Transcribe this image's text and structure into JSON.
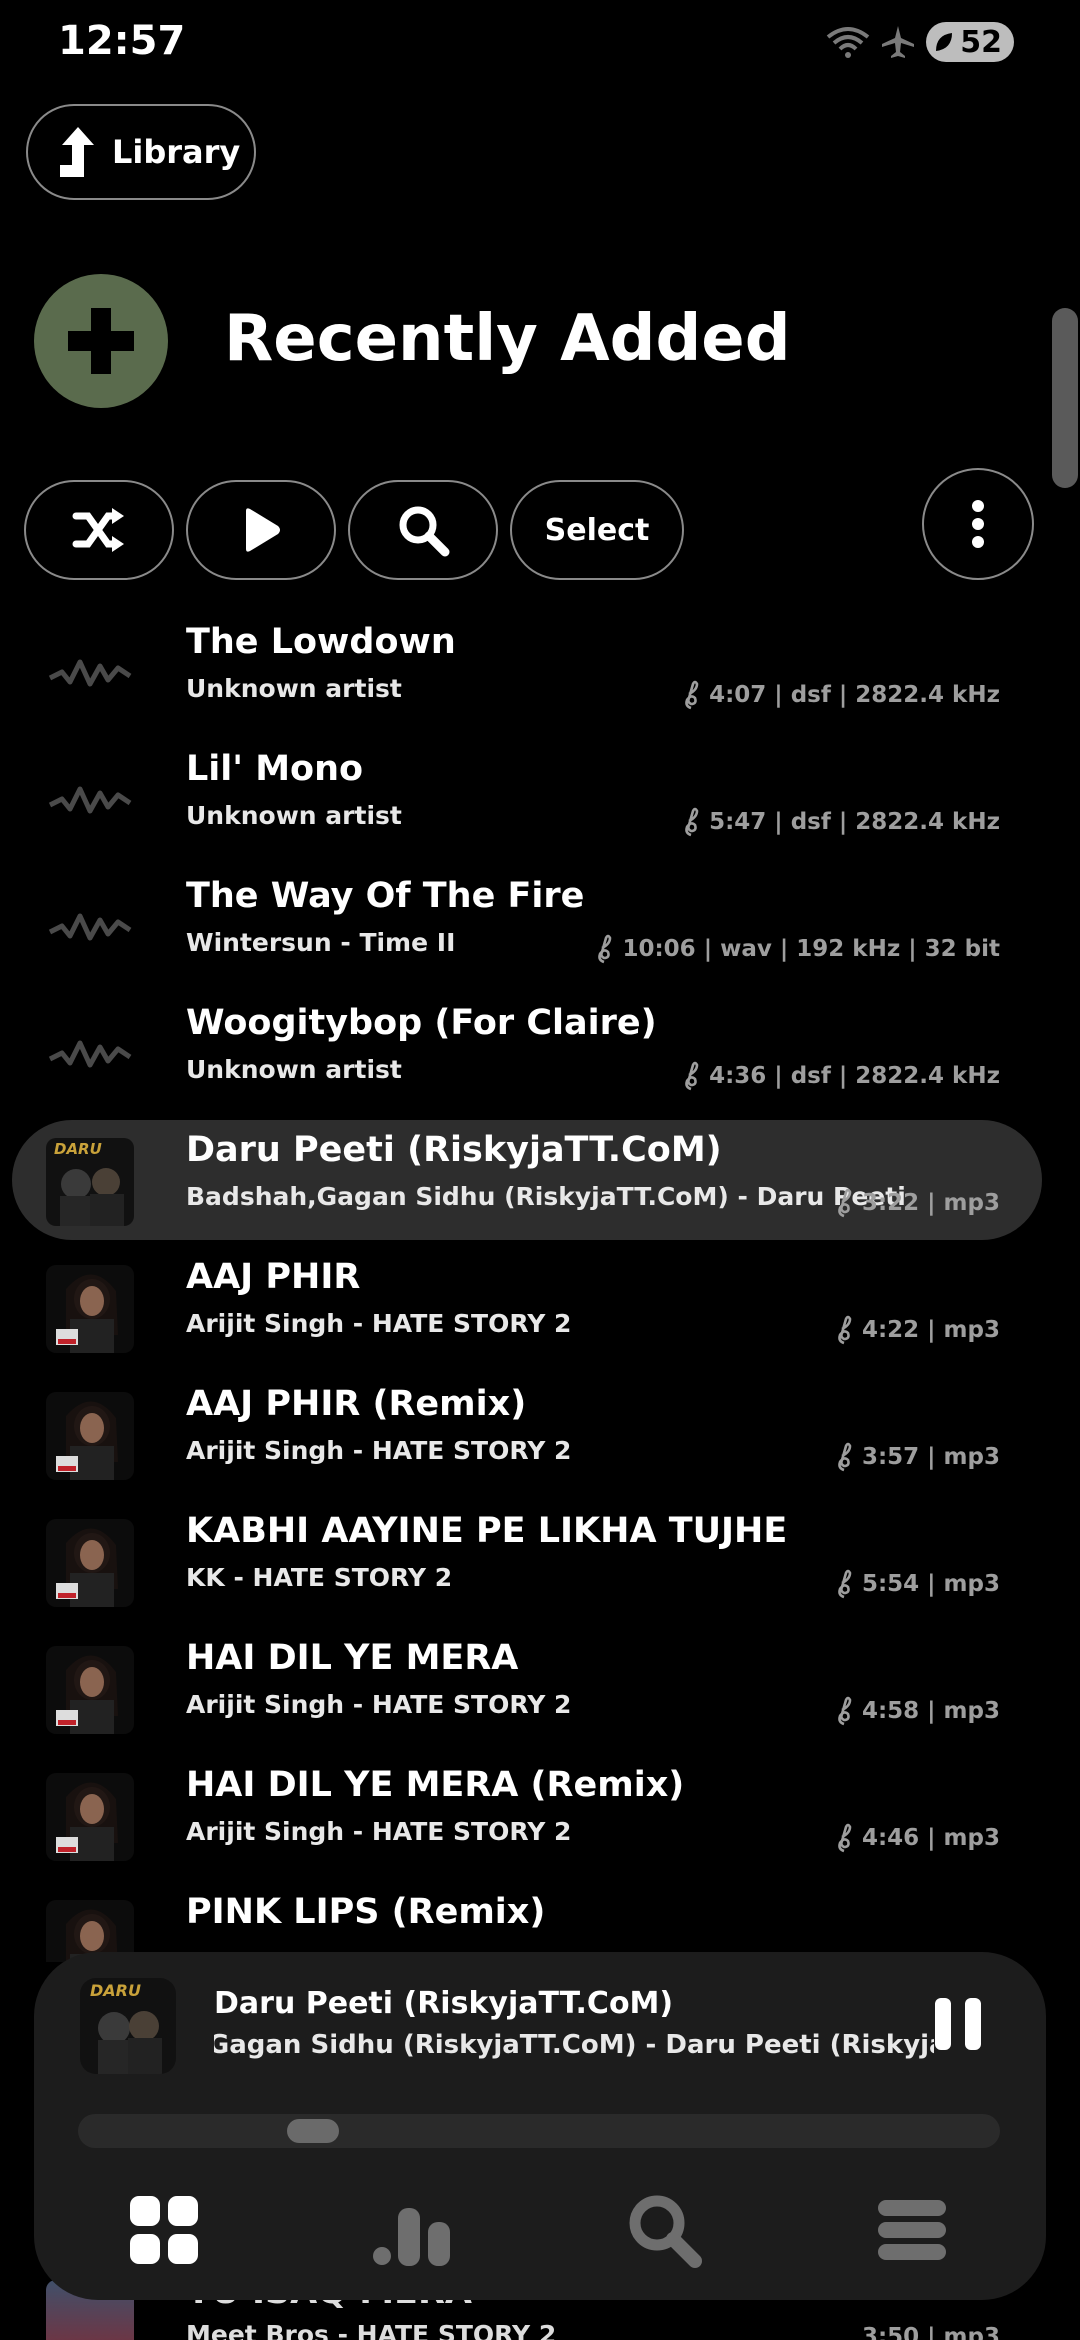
{
  "status_bar": {
    "time": "12:57",
    "battery": "52"
  },
  "library_button": {
    "label": "Library"
  },
  "page_title": "Recently Added",
  "toolbar": {
    "select_label": "Select"
  },
  "tracks": [
    {
      "title": "The Lowdown",
      "subtitle": "Unknown artist",
      "meta": "4:07 | dsf | 2822.4 kHz",
      "art": "waveform"
    },
    {
      "title": "Lil' Mono",
      "subtitle": "Unknown artist",
      "meta": "5:47 | dsf | 2822.4 kHz",
      "art": "waveform"
    },
    {
      "title": "The Way Of The Fire",
      "subtitle": "Wintersun - Time II",
      "meta": "10:06 | wav | 192 kHz | 32 bit",
      "art": "waveform"
    },
    {
      "title": "Woogitybop (For Claire)",
      "subtitle": "Unknown artist",
      "meta": "4:36 | dsf | 2822.4 kHz",
      "art": "waveform"
    },
    {
      "title": "Daru Peeti (RiskyjaTT.CoM)",
      "subtitle": "Badshah,Gagan Sidhu (RiskyjaTT.CoM) - Daru Peeti",
      "meta": "3:22 | mp3",
      "art": "album-daru",
      "active": true
    },
    {
      "title": "AAJ PHIR",
      "subtitle": "Arijit Singh - HATE STORY 2",
      "meta": "4:22 | mp3",
      "art": "album-hate-story"
    },
    {
      "title": "AAJ PHIR (Remix)",
      "subtitle": "Arijit Singh - HATE STORY 2",
      "meta": "3:57 | mp3",
      "art": "album-hate-story"
    },
    {
      "title": "KABHI AAYINE PE LIKHA TUJHE",
      "subtitle": "KK - HATE STORY 2",
      "meta": "5:54 | mp3",
      "art": "album-hate-story"
    },
    {
      "title": "HAI DIL YE MERA",
      "subtitle": "Arijit Singh - HATE STORY 2",
      "meta": "4:58 | mp3",
      "art": "album-hate-story"
    },
    {
      "title": "HAI DIL YE MERA (Remix)",
      "subtitle": "Arijit Singh - HATE STORY 2",
      "meta": "4:46 | mp3",
      "art": "album-hate-story"
    },
    {
      "title": "PINK LIPS (Remix)",
      "subtitle": "",
      "meta": "",
      "art": "album-hate-story"
    }
  ],
  "now_playing": {
    "title": "Daru Peeti (RiskyjaTT.CoM)",
    "subtitle": "Badshah,Gagan Sidhu (RiskyjaTT.CoM) - Daru Peeti (RiskyjaTT.CoM)",
    "progress": 0.24
  },
  "bottom_nav": [
    "grid-icon",
    "bar-chart-icon",
    "search-icon",
    "menu-icon"
  ],
  "peek_track": {
    "title": "YU ISAQ MERA",
    "subtitle": "Meet Bros - HATE STORY 2",
    "meta": "3:50 | mp3"
  }
}
